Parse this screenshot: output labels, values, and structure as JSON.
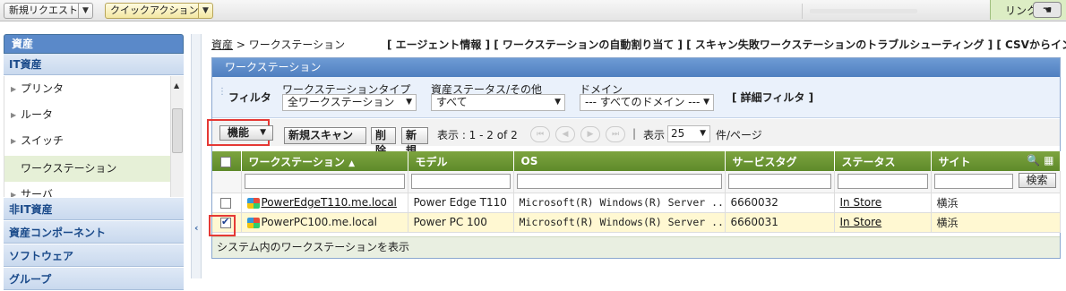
{
  "topbar": {
    "new_request": "新規リクエスト",
    "quick_action": "クイックアクション",
    "link": "リンク"
  },
  "sidebar": {
    "header": "資産",
    "subheader": "IT資産",
    "items": [
      {
        "label": "プリンタ"
      },
      {
        "label": "ルータ"
      },
      {
        "label": "スイッチ"
      },
      {
        "label": "ワークステーション"
      },
      {
        "label": "サーバ"
      }
    ],
    "categories": [
      "非IT資産",
      "資産コンポーネント",
      "ソフトウェア",
      "グループ"
    ]
  },
  "breadcrumb": {
    "root": "資産",
    "sep": " > ",
    "current": "ワークステーション"
  },
  "actions": "[ エージェント情報 ] [ ワークステーションの自動割り当て ] [ スキャン失敗ワークステーションのトラブルシューティング ] [ CSVからインポート ]",
  "panel": {
    "title": "ワークステーション",
    "filter": {
      "label": "フィルタ",
      "type_label": "ワークステーションタイプ",
      "type_value": "全ワークステーション",
      "status_label": "資産ステータス/その他",
      "status_value": "すべて",
      "domain_label": "ドメイン",
      "domain_value": "--- すべてのドメイン ---",
      "advanced": "[ 詳細フィルタ ]"
    },
    "toolbar": {
      "functions": "機能",
      "new_scan": "新規スキャン",
      "delete": "削除",
      "new": "新規",
      "display": "表示 : 1 - 2 of 2",
      "show": "表示",
      "per_page_value": "25",
      "per_page": "件/ページ"
    },
    "columns": [
      "ワークステーション",
      "モデル",
      "OS",
      "サービスタグ",
      "ステータス",
      "サイト"
    ],
    "search_button": "検索",
    "rows": [
      {
        "name": "PowerEdgeT110.me.local",
        "model": "Power Edge T110",
        "os": "Microsoft(R) Windows(R) Server ...",
        "tag": "6660032",
        "status": "In Store",
        "site": "横浜",
        "checked": false
      },
      {
        "name": "PowerPC100.me.local",
        "model": "Power PC 100",
        "os": "Microsoft(R) Windows(R) Server ...",
        "tag": "6660031",
        "status": "In Store",
        "site": "横浜",
        "checked": true
      }
    ],
    "footer": "システム内のワークステーションを表示"
  },
  "colors": {
    "accent": "#5a89c9",
    "grid_header": "#6b952f",
    "highlight": "#e53935"
  }
}
